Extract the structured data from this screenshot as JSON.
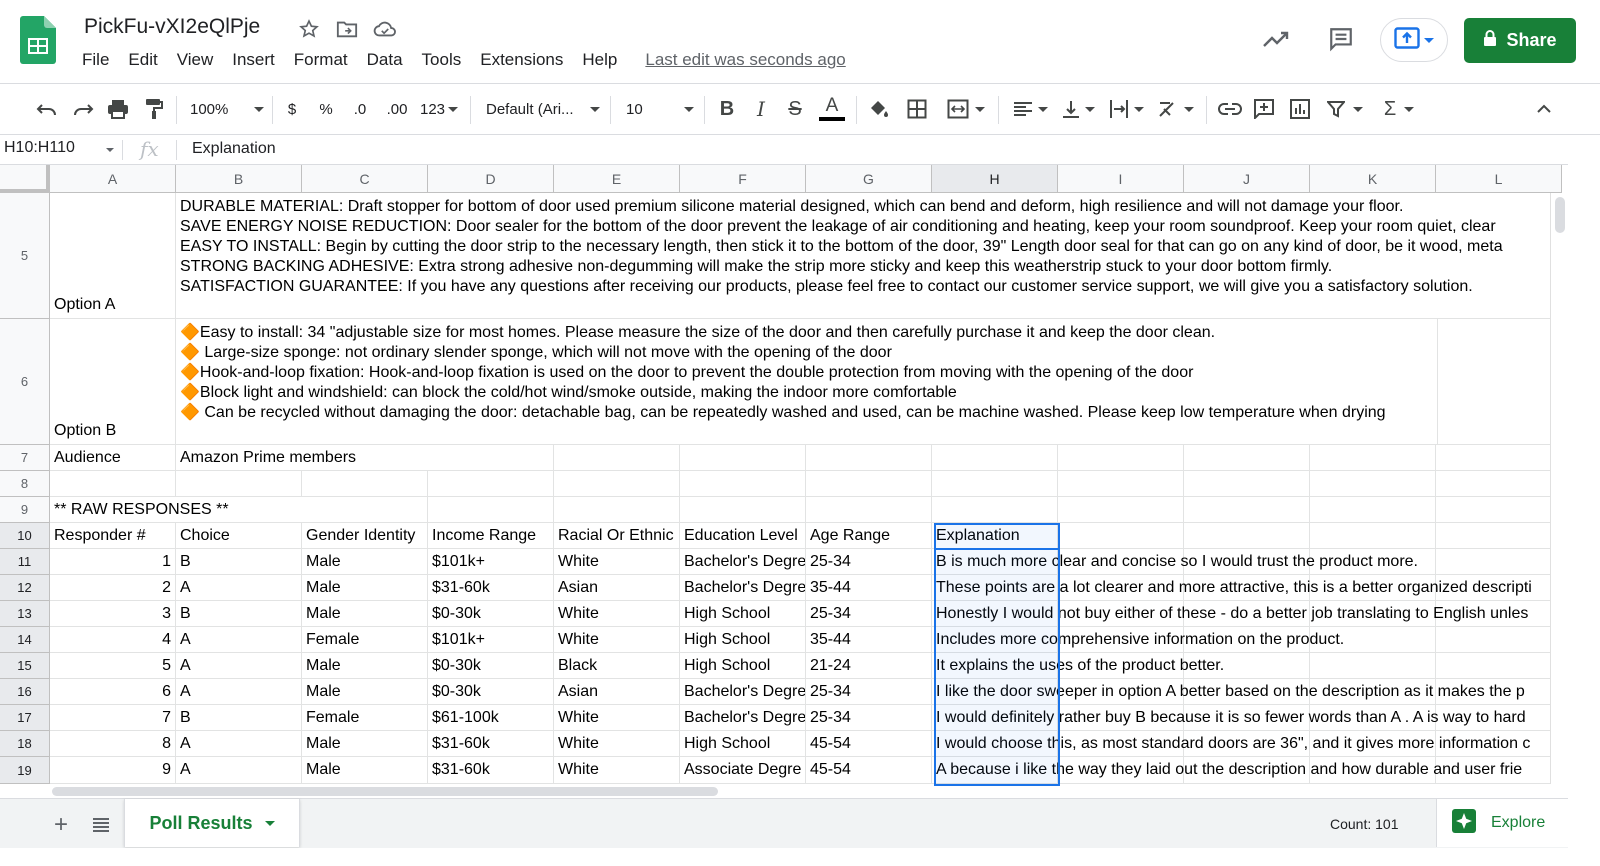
{
  "app": {
    "doc_title": "PickFu-vXI2eQlPje",
    "last_edit": "Last edit was seconds ago",
    "share_label": "Share",
    "brand_color": "#188038",
    "icons": [
      "sheets-logo",
      "star-icon",
      "move-to-folder-icon",
      "cloud-status-icon",
      "activity-trend-icon",
      "comments-icon",
      "present-icon",
      "lock-icon"
    ]
  },
  "menu": [
    "File",
    "Edit",
    "View",
    "Insert",
    "Format",
    "Data",
    "Tools",
    "Extensions",
    "Help"
  ],
  "toolbar": {
    "zoom": "100%",
    "currency": "$",
    "percent": "%",
    "decrease_decimal": ".0",
    "increase_decimal": ".00",
    "more_formats": "123",
    "font_family": "Default (Ari...",
    "font_size": "10"
  },
  "formula_bar": {
    "name_box": "H10:H110",
    "fx": "fx",
    "value": "Explanation"
  },
  "columns": [
    "A",
    "B",
    "C",
    "D",
    "E",
    "F",
    "G",
    "H",
    "I",
    "J",
    "K",
    "L"
  ],
  "selected_column": "H",
  "rows": [
    "5",
    "6",
    "7",
    "8",
    "9",
    "10",
    "11",
    "12",
    "13",
    "14",
    "15",
    "16",
    "17",
    "18",
    "19"
  ],
  "option_a": {
    "label": "Option A",
    "text": "DURABLE MATERIAL: Draft stopper for bottom of door used premium silicone material designed, which can bend and deform, high resilience and will not damage your floor.\nSAVE ENERGY NOISE REDUCTION: Door sealer for the bottom of the door prevent the leakage of air conditioning and heating, keep your room soundproof. Keep your room quiet, clear\nEASY TO INSTALL: Begin by cutting the door strip to the necessary length, then stick it to the bottom of the door, 39\" Length door seal for that can go on any kind of door, be it wood, meta\nSTRONG BACKING ADHESIVE: Extra strong adhesive non-degumming will make the strip more sticky and keep this weatherstrip stuck to your door bottom firmly.\nSATISFACTION GUARANTEE: If you have any questions after receiving our products, please feel free to contact our customer service support, we will give you a satisfactory solution."
  },
  "option_b": {
    "label": "Option B",
    "text": "🔶Easy to install: 34 \"adjustable size for most homes. Please measure the size of the door and then carefully purchase it and keep the door clean.\n🔶 Large-size sponge: not ordinary slender sponge, which will not move with the opening of the door\n🔶Hook-and-loop fixation: Hook-and-loop fixation is used on the door to prevent the double protection from moving with the opening of the door\n🔶Block light and windshield: can block the cold/hot wind/smoke outside, making the indoor more comfortable\n🔶 Can be recycled without damaging the door: detachable bag, can be repeatedly washed and used, can be machine washed. Please keep low temperature when drying"
  },
  "audience": {
    "label": "Audience",
    "value": "Amazon Prime members"
  },
  "raw_title": "** RAW RESPONSES **",
  "table_headers": [
    "Responder #",
    "Choice",
    "Gender Identity",
    "Income Range",
    "Racial Or Ethnic",
    "Education Level",
    "Age Range",
    "Explanation"
  ],
  "responses": [
    {
      "n": "1",
      "choice": "B",
      "gender": "Male",
      "income": "$101k+",
      "race": "White",
      "edu": "Bachelor's Degre",
      "age": "25-34",
      "explanation": "B is much more clear and concise so I would trust the product more."
    },
    {
      "n": "2",
      "choice": "A",
      "gender": "Male",
      "income": "$31-60k",
      "race": "Asian",
      "edu": "Bachelor's Degre",
      "age": "35-44",
      "explanation": "These points are a lot clearer and more attractive, this is a better organized descripti"
    },
    {
      "n": "3",
      "choice": "B",
      "gender": "Male",
      "income": "$0-30k",
      "race": "White",
      "edu": "High School",
      "age": "25-34",
      "explanation": "Honestly I would not buy either of these - do a better job translating to English unles"
    },
    {
      "n": "4",
      "choice": "A",
      "gender": "Female",
      "income": "$101k+",
      "race": "White",
      "edu": "High School",
      "age": "35-44",
      "explanation": "Includes more comprehensive information on the product."
    },
    {
      "n": "5",
      "choice": "A",
      "gender": "Male",
      "income": "$0-30k",
      "race": "Black",
      "edu": "High School",
      "age": "21-24",
      "explanation": "It explains the uses of the product better."
    },
    {
      "n": "6",
      "choice": "A",
      "gender": "Male",
      "income": "$0-30k",
      "race": "Asian",
      "edu": "Bachelor's Degre",
      "age": "25-34",
      "explanation": "I like the door sweeper in option A better based on the description as it makes the p"
    },
    {
      "n": "7",
      "choice": "B",
      "gender": "Female",
      "income": "$61-100k",
      "race": "White",
      "edu": "Bachelor's Degre",
      "age": "25-34",
      "explanation": "I would definitely rather buy B because it is so fewer words than A . A is way to hard"
    },
    {
      "n": "8",
      "choice": "A",
      "gender": "Male",
      "income": "$31-60k",
      "race": "White",
      "edu": "High School",
      "age": "45-54",
      "explanation": "I would choose this, as most standard doors are 36\", and it gives more information c"
    },
    {
      "n": "9",
      "choice": "A",
      "gender": "Male",
      "income": "$31-60k",
      "race": "White",
      "edu": "Associate Degre",
      "age": "45-54",
      "explanation": "A because i like the way they laid out the description and how durable and user frie"
    }
  ],
  "bottom": {
    "sheet_name": "Poll Results",
    "count": "Count: 101",
    "explore": "Explore"
  }
}
